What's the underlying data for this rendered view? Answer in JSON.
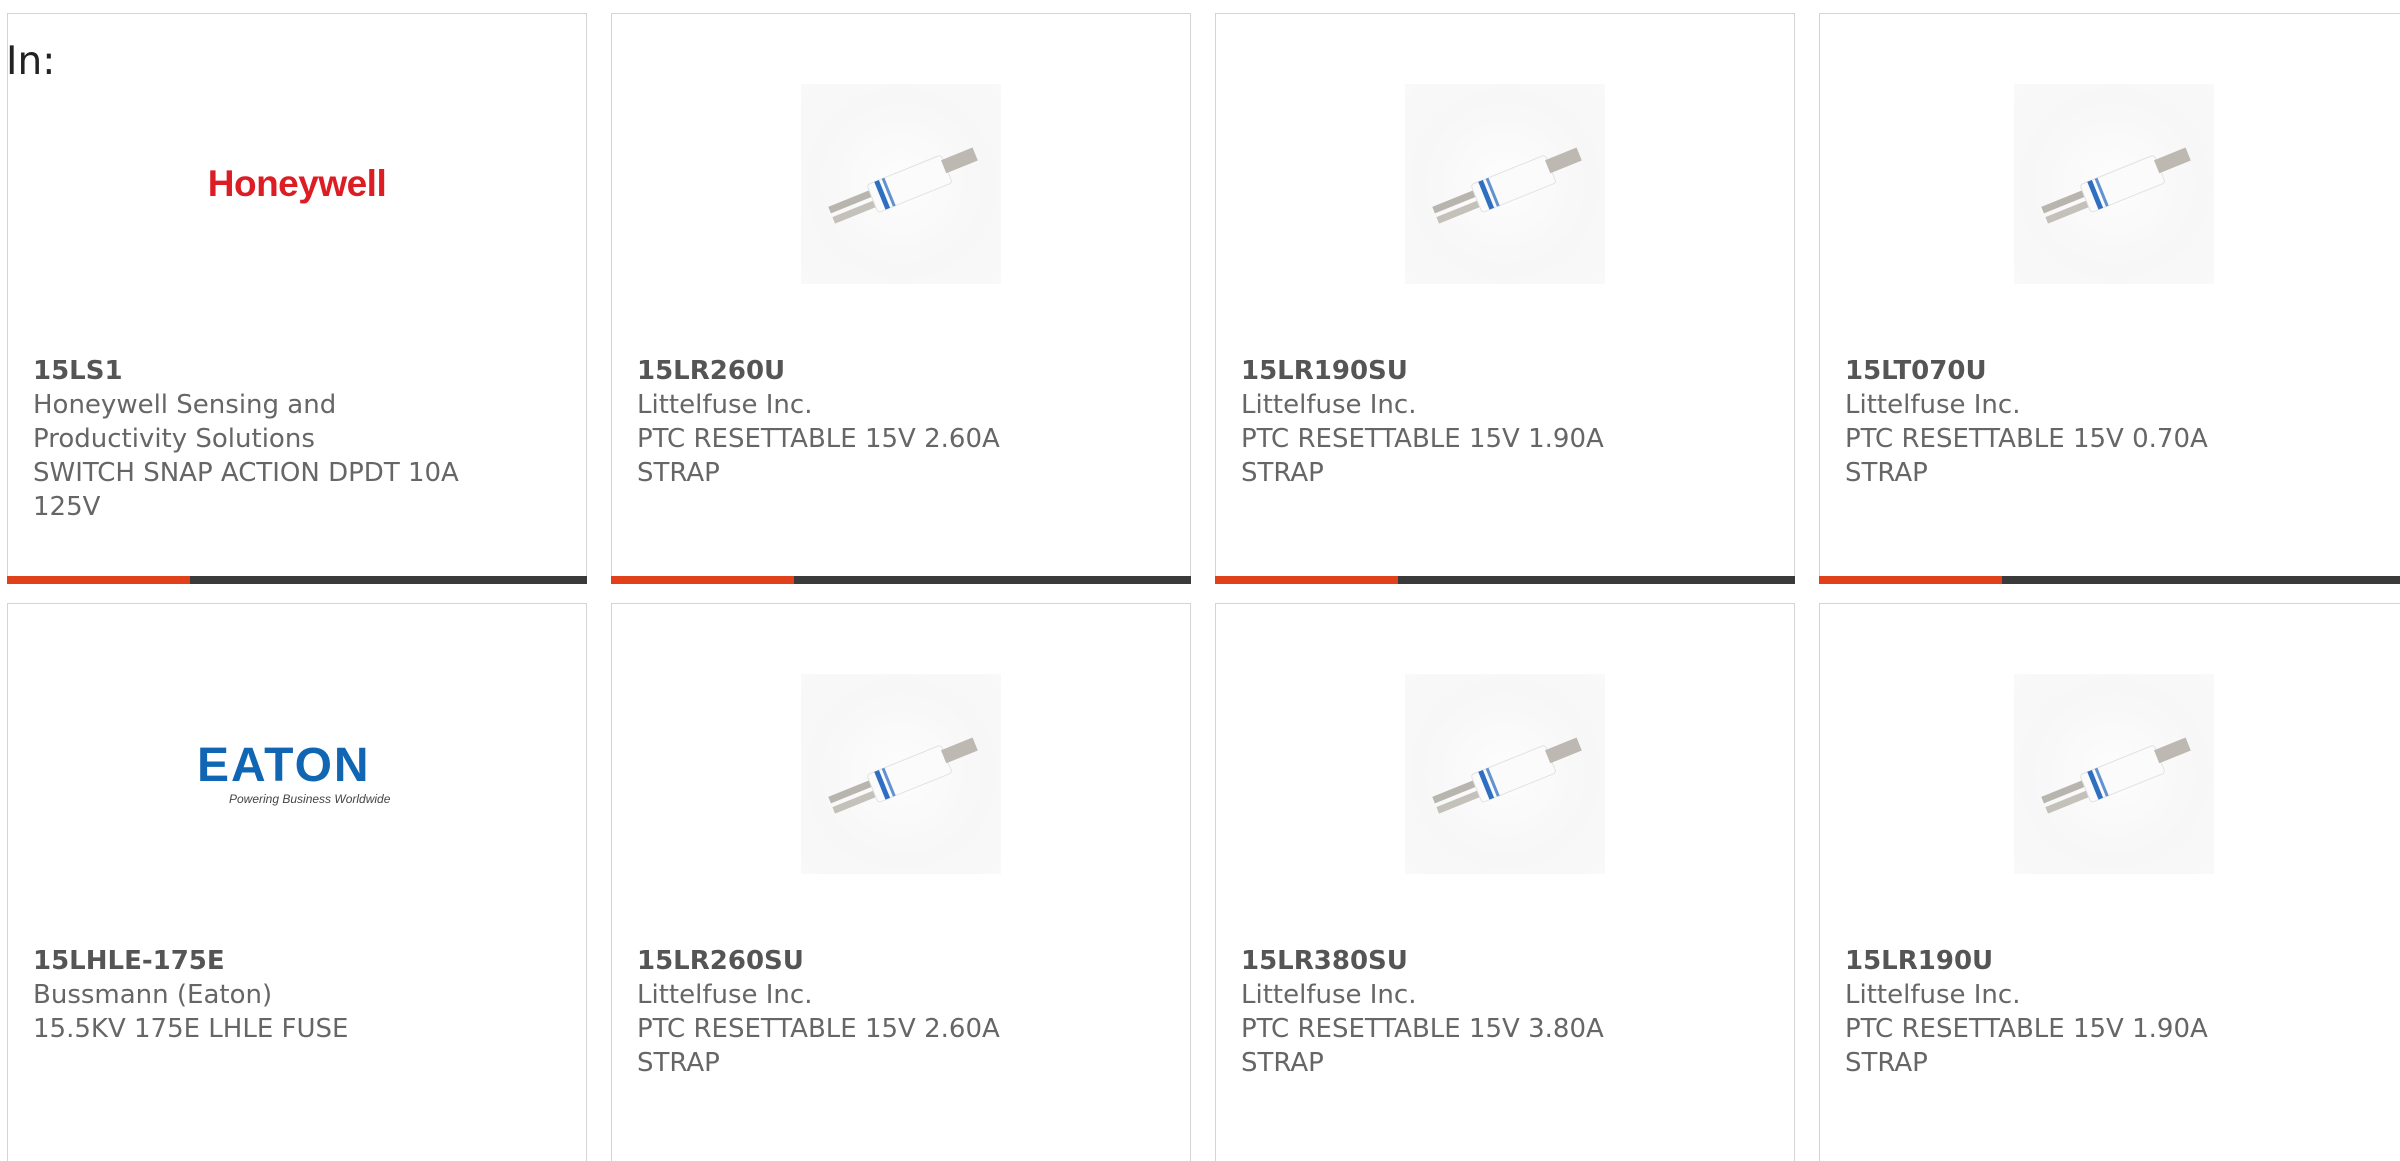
{
  "filter_label": "In:",
  "products": [
    {
      "part": "15LS1",
      "manufacturer_lines": [
        "Honeywell Sensing and",
        "Productivity Solutions"
      ],
      "description": "SWITCH SNAP ACTION DPDT 10A 125V",
      "logo_text": "Honeywell",
      "image_type": "honeywell-logo"
    },
    {
      "part": "15LR260U",
      "manufacturer": "Littelfuse Inc.",
      "description": "PTC RESETTABLE 15V 2.60A STRAP",
      "image_type": "ptc-strap-image"
    },
    {
      "part": "15LR190SU",
      "manufacturer": "Littelfuse Inc.",
      "description": "PTC RESETTABLE 15V 1.90A STRAP",
      "image_type": "ptc-strap-image"
    },
    {
      "part": "15LT070U",
      "manufacturer": "Littelfuse Inc.",
      "description": "PTC RESETTABLE 15V 0.70A STRAP",
      "image_type": "ptc-strap-image"
    },
    {
      "part": "15LHLE-175E",
      "manufacturer": "Bussmann (Eaton)",
      "description": "15.5KV 175E LHLE FUSE",
      "logo_text": "EATON",
      "logo_tagline": "Powering Business Worldwide",
      "image_type": "eaton-logo"
    },
    {
      "part": "15LR260SU",
      "manufacturer": "Littelfuse Inc.",
      "description": "PTC RESETTABLE 15V 2.60A STRAP",
      "image_type": "ptc-strap-image"
    },
    {
      "part": "15LR380SU",
      "manufacturer": "Littelfuse Inc.",
      "description": "PTC RESETTABLE 15V 3.80A STRAP",
      "image_type": "ptc-strap-image"
    },
    {
      "part": "15LR190U",
      "manufacturer": "Littelfuse Inc.",
      "description": "PTC RESETTABLE 15V 1.90A STRAP",
      "image_type": "ptc-strap-image"
    }
  ],
  "colors": {
    "accent": "#e0401a",
    "bar": "#3a3a3a",
    "honeywell_red": "#dc1e24",
    "eaton_blue": "#1166b3",
    "strap_blue": "#2f6fc2"
  }
}
